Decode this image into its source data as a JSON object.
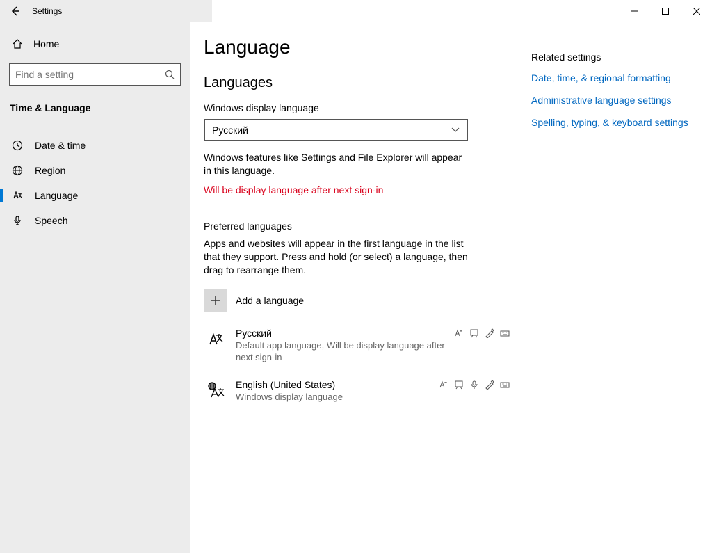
{
  "window": {
    "title": "Settings"
  },
  "sidebar": {
    "home_label": "Home",
    "search_placeholder": "Find a setting",
    "category_title": "Time & Language",
    "items": [
      {
        "label": "Date & time"
      },
      {
        "label": "Region"
      },
      {
        "label": "Language"
      },
      {
        "label": "Speech"
      }
    ]
  },
  "main": {
    "page_title": "Language",
    "languages_heading": "Languages",
    "display_lang_label": "Windows display language",
    "display_lang_value": "Русский",
    "display_lang_help": "Windows features like Settings and File Explorer will appear in this language.",
    "display_lang_notice": "Will be display language after next sign-in",
    "preferred_heading": "Preferred languages",
    "preferred_help": "Apps and websites will appear in the first language in the list that they support. Press and hold (or select) a language, then drag to rearrange them.",
    "add_language_label": "Add a language",
    "languages": [
      {
        "name": "Русский",
        "sub": "Default app language, Will be display language after next sign-in"
      },
      {
        "name": "English (United States)",
        "sub": "Windows display language"
      }
    ]
  },
  "related": {
    "title": "Related settings",
    "links": [
      "Date, time, & regional formatting",
      "Administrative language settings",
      "Spelling, typing, & keyboard settings"
    ]
  }
}
